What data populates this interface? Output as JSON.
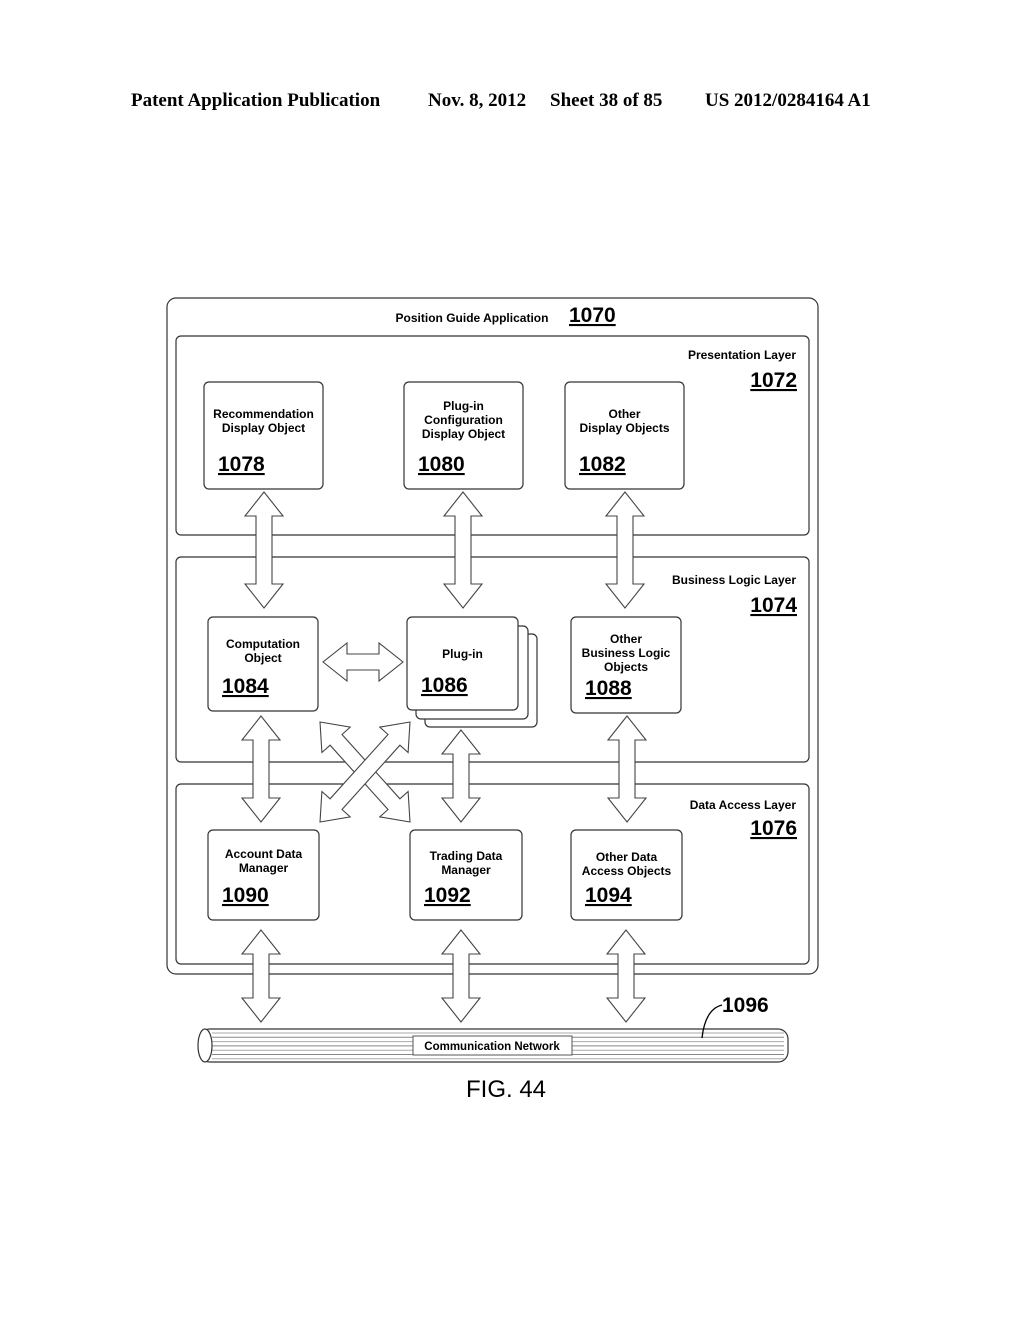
{
  "header": {
    "publication": "Patent Application Publication",
    "date": "Nov. 8, 2012",
    "sheet": "Sheet 38 of 85",
    "patent_number": "US 2012/0284164 A1"
  },
  "application": {
    "label": "Position Guide Application",
    "ref": "1070"
  },
  "layers": {
    "presentation": {
      "label": "Presentation Layer",
      "ref": "1072"
    },
    "business": {
      "label": "Business Logic Layer",
      "ref": "1074"
    },
    "data_access": {
      "label": "Data Access Layer",
      "ref": "1076"
    }
  },
  "objects": {
    "recommendation": {
      "lines": [
        "Recommendation",
        "Display Object"
      ],
      "ref": "1078"
    },
    "plugin_config": {
      "lines": [
        "Plug-in",
        "Configuration",
        "Display Object"
      ],
      "ref": "1080"
    },
    "other_display": {
      "lines": [
        "Other",
        "Display Objects"
      ],
      "ref": "1082"
    },
    "computation": {
      "lines": [
        "Computation",
        "Object"
      ],
      "ref": "1084"
    },
    "plugin": {
      "lines": [
        "Plug-in"
      ],
      "ref": "1086"
    },
    "other_business": {
      "lines": [
        "Other",
        "Business Logic",
        "Objects"
      ],
      "ref": "1088"
    },
    "account_data": {
      "lines": [
        "Account Data",
        "Manager"
      ],
      "ref": "1090"
    },
    "trading_data": {
      "lines": [
        "Trading Data",
        "Manager"
      ],
      "ref": "1092"
    },
    "other_data": {
      "lines": [
        "Other Data",
        "Access Objects"
      ],
      "ref": "1094"
    }
  },
  "network": {
    "label": "Communication Network",
    "ref": "1096"
  },
  "figure_caption": "FIG. 44"
}
